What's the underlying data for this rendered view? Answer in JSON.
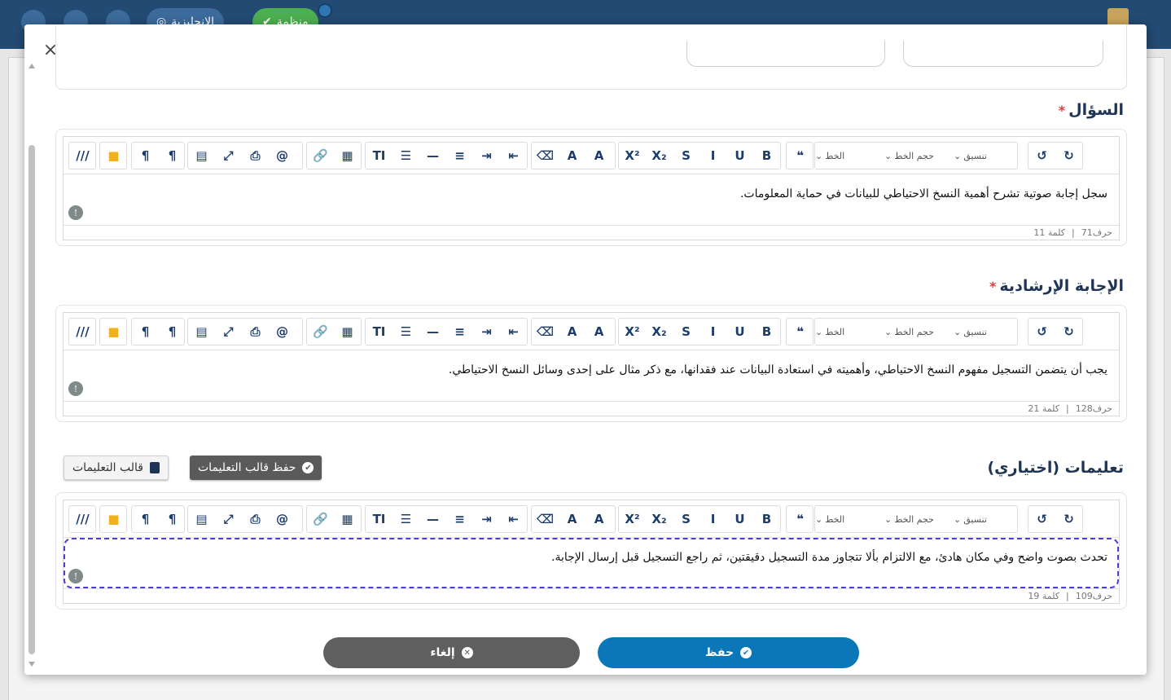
{
  "appbar": {
    "lang_label": "الإنجليزية",
    "status_label": "منظمة"
  },
  "modal": {
    "question": {
      "title": "السؤال",
      "required_mark": "*",
      "text": "سجل إجابة صوتية تشرح أهمية النسخ الاحتياطي للبيانات في حماية المعلومات.",
      "chars": "حرف71",
      "words": "كلمة 11"
    },
    "guide_answer": {
      "title": "الإجابة الإرشادية",
      "required_mark": "*",
      "text": "يجب أن يتضمن التسجيل مفهوم النسخ الاحتياطي، وأهميته في استعادة البيانات عند فقدانها، مع ذكر مثال على إحدى وسائل النسخ الاحتياطي.",
      "chars": "حرف128",
      "words": "كلمة 21"
    },
    "instructions": {
      "title": "تعليمات (اختياري)",
      "text": "تحدث بصوت واضح وفي مكان هادئ، مع الالتزام بألا تتجاوز مدة التسجيل دقيقتين، ثم راجع التسجيل قبل إرسال الإجابة.",
      "chars": "حرف109",
      "words": "كلمة 19",
      "save_template_label": "حفظ قالب التعليمات",
      "template_label": "قالب التعليمات"
    },
    "toolbar": {
      "format_label": "تنسيق",
      "font_size_label": "حجم الخط",
      "font_label": "الخط",
      "quote_glyph": "❝",
      "sup_glyph": "X²",
      "sub_glyph": "X₂",
      "strike_glyph": "S",
      "italic_glyph": "I",
      "underline_glyph": "U",
      "bold_glyph": "B",
      "eraser_glyph": "⌫",
      "bgcolor_glyph": "A",
      "fontcolor_glyph": "A",
      "tt_glyph": "TI",
      "ol_glyph": "☰",
      "hr_glyph": "—",
      "align_glyph": "≡",
      "indent_glyph": "⇥",
      "outdent_glyph": "⇤",
      "link_glyph": "🔗",
      "table_glyph": "▦",
      "template_glyph": "▤",
      "fullscreen_glyph": "⤢",
      "print_glyph": "⎙",
      "mention_glyph": "@",
      "rtl_glyph": "¶",
      "ltr_glyph": "¶",
      "folder_glyph": "■",
      "more_glyph": "///"
    },
    "save_label": "حفظ",
    "cancel_label": "إلغاء",
    "close_glyph": "×"
  },
  "colors": {
    "primary": "#0a77b8",
    "secondary": "#5f5f5f",
    "heading": "#1f3556",
    "dashed": "#4a3ed1"
  }
}
